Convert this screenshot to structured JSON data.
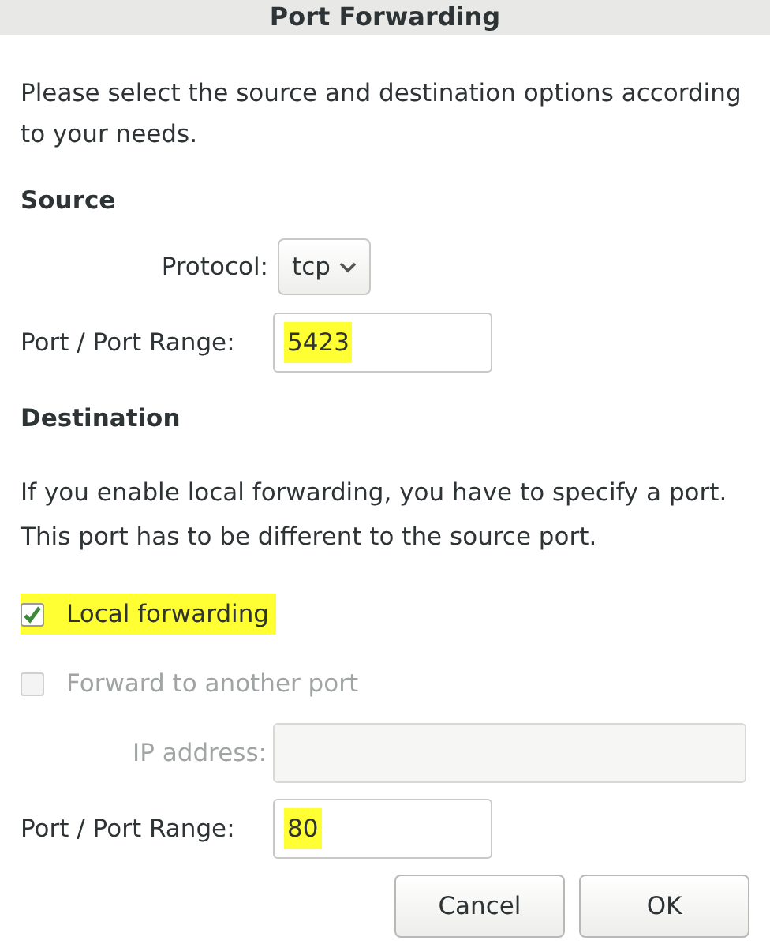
{
  "window": {
    "title": "Port Forwarding"
  },
  "intro": "Please select the source and destination options according to your needs.",
  "source": {
    "heading": "Source",
    "protocol_label": "Protocol:",
    "protocol_value": "tcp",
    "port_label": "Port / Port Range:",
    "port_value": "5423",
    "port_highlighted": true
  },
  "destination": {
    "heading": "Destination",
    "note": "If you enable local forwarding, you have to specify a port. This port has to be different to the source port.",
    "options": [
      {
        "label": "Local forwarding",
        "checked": true,
        "disabled": false,
        "highlighted": true
      },
      {
        "label": "Forward to another port",
        "checked": false,
        "disabled": true,
        "highlighted": false
      }
    ],
    "ip_label": "IP address:",
    "ip_disabled": true,
    "port_label": "Port / Port Range:",
    "port_value": "80",
    "port_highlighted": true
  },
  "buttons": [
    "Cancel",
    "OK"
  ]
}
